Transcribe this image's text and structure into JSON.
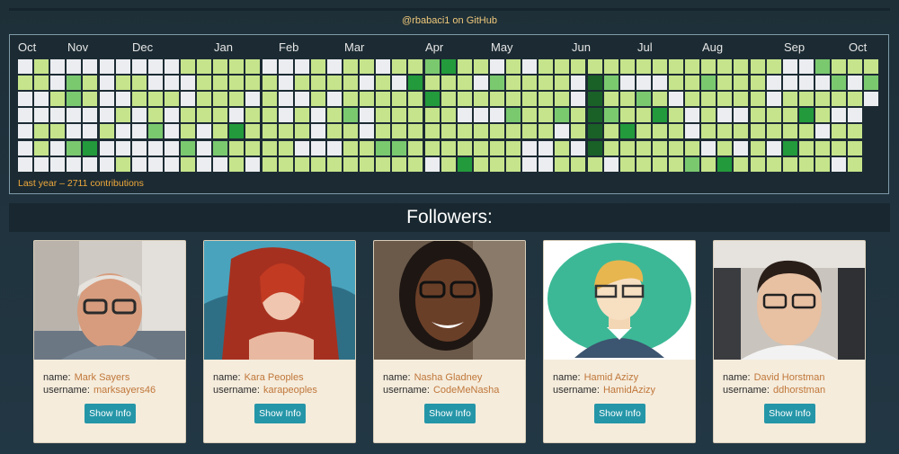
{
  "header": {
    "title": "@rbabaci1 on GitHub"
  },
  "calendar": {
    "months": [
      "Oct",
      "Nov",
      "Dec",
      "Jan",
      "Feb",
      "Mar",
      "Apr",
      "May",
      "Jun",
      "Jul",
      "Aug",
      "Sep",
      "Oct"
    ],
    "total_label": "Last year – 2711 contributions",
    "colors": {
      "empty": "#ebedf0",
      "l1": "#c6e48b",
      "l2": "#7bc96f",
      "l3": "#239a3b",
      "l4": "#196127"
    }
  },
  "followers": {
    "title": "Followers:",
    "name_label": "name:",
    "username_label": "username:",
    "button_label": "Show Info",
    "items": [
      {
        "name": "Mark Sayers",
        "username": "marksayers46"
      },
      {
        "name": "Kara Peoples",
        "username": "karapeoples"
      },
      {
        "name": "Nasha Gladney",
        "username": "CodeMeNasha"
      },
      {
        "name": "Hamid Azizy",
        "username": "HamidAzizy"
      },
      {
        "name": "David Horstman",
        "username": "ddhorstman"
      }
    ]
  }
}
